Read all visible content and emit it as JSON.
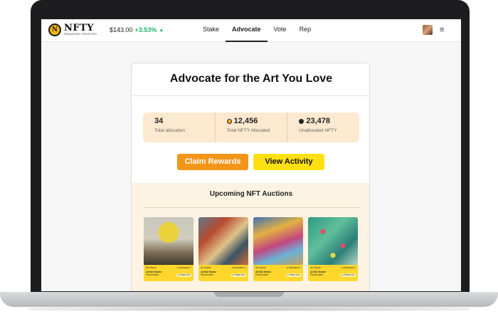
{
  "nav": {
    "logo_glyph": "N",
    "logo_word": "NFTY",
    "logo_tagline": "REWARDING CREATIVES",
    "price": "$143.00",
    "change": "+3.53%",
    "change_arrow": "▲",
    "links": [
      "Stake",
      "Advocate",
      "Vote",
      "Rep"
    ],
    "active_link": "Advocate",
    "menu_icon": "≡"
  },
  "card": {
    "title": "Advocate for the Art You Love",
    "stats": [
      {
        "value": "34",
        "label": "Total allocation",
        "icon": ""
      },
      {
        "value": "12,456",
        "label": "Total NFTY Allocated",
        "icon": "nfty-coin-icon"
      },
      {
        "value": "23,478",
        "label": "Unallocated NFTY",
        "icon": "dark-coin-icon"
      }
    ],
    "claim_label": "Claim Rewards",
    "activity_label": "View Activity"
  },
  "auctions": {
    "title": "Upcoming NFT Auctions",
    "items": [
      {
        "top_left": "Art Name",
        "top_right": "● Allocated 2",
        "artist": "Artist Name",
        "sub": "Placeholder",
        "pill": "● Place bid"
      },
      {
        "top_left": "Art Name",
        "top_right": "● Allocated 2",
        "artist": "Artist Name",
        "sub": "Placeholder",
        "pill": "● Place bid"
      },
      {
        "top_left": "Art Name",
        "top_right": "● Allocated 2",
        "artist": "Artist Name",
        "sub": "Placeholder",
        "pill": "● Place bid"
      },
      {
        "top_left": "Art Name",
        "top_right": "● Allocated 2",
        "artist": "Artist Name",
        "sub": "Placeholder",
        "pill": "● Place bid"
      }
    ]
  },
  "colors": {
    "accent_orange": "#f39519",
    "accent_yellow": "#fde012",
    "positive": "#20b46a"
  }
}
